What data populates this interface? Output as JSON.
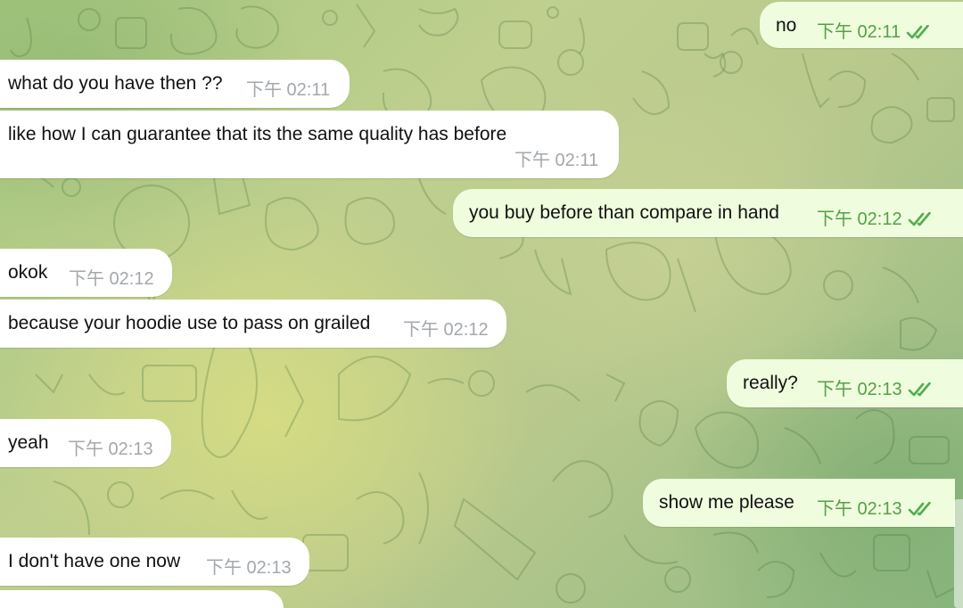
{
  "messages": [
    {
      "direction": "out",
      "text": "no",
      "time": "下午 02:11",
      "status_icon": "double-check-icon"
    },
    {
      "direction": "in",
      "text": "what do you have then ??",
      "time": "下午 02:11"
    },
    {
      "direction": "in",
      "text": "like how I can guarantee that its the same quality has before",
      "time": "下午 02:11"
    },
    {
      "direction": "out",
      "text": "you buy before than compare in hand",
      "time": "下午 02:12",
      "status_icon": "double-check-icon"
    },
    {
      "direction": "in",
      "text": "okok",
      "time": "下午 02:12"
    },
    {
      "direction": "in",
      "text": "because your hoodie use to pass on grailed",
      "time": "下午 02:12"
    },
    {
      "direction": "out",
      "text": "really?",
      "time": "下午 02:13",
      "status_icon": "double-check-icon"
    },
    {
      "direction": "in",
      "text": "yeah",
      "time": "下午 02:13"
    },
    {
      "direction": "out",
      "text": "show me please",
      "time": "下午 02:13",
      "status_icon": "double-check-icon"
    },
    {
      "direction": "in",
      "text": "I don't have one now",
      "time": "下午 02:13"
    }
  ],
  "theme": {
    "incoming_bubble": "#ffffff",
    "outgoing_bubble": "#effdde",
    "outgoing_time": "#55a045",
    "incoming_time": "#a3a8ad",
    "tick_color": "#4fae4e"
  }
}
